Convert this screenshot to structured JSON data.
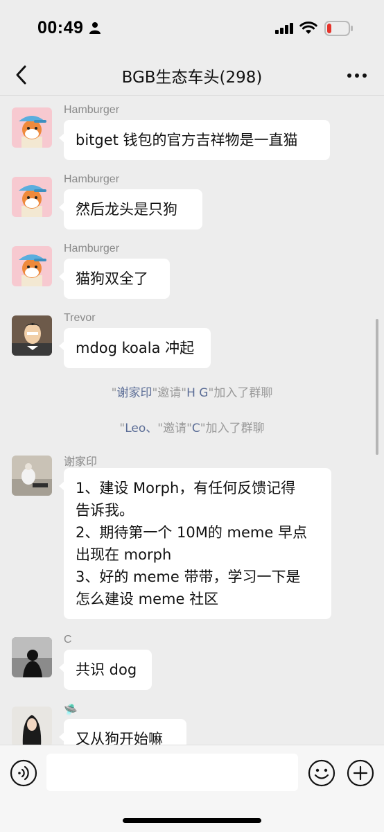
{
  "status_bar": {
    "time": "00:49",
    "battery_color": "#e5332a"
  },
  "header": {
    "title": "BGB生态车头(298)",
    "back_icon": "chevron-left-icon",
    "more_icon": "more-dots-icon"
  },
  "messages": [
    {
      "sender": "Hamburger",
      "text": "bitget 钱包的官方吉祥物是一直猫"
    },
    {
      "sender": "Hamburger",
      "text": "然后龙头是只狗"
    },
    {
      "sender": "Hamburger",
      "text": "猫狗双全了"
    },
    {
      "sender": "Trevor",
      "text": "mdog koala 冲起"
    },
    {
      "sender": "谢家印",
      "lines": [
        "1、建设 Morph，有任何反馈记得",
        "告诉我。",
        "2、期待第一个 10M的 meme 早点",
        "出现在 morph",
        "3、好的 meme 带带，学习一下是",
        "怎么建设 meme 社区"
      ]
    },
    {
      "sender": "C",
      "text": "共识 dog"
    },
    {
      "sender": "🛸",
      "text": "又从狗开始嘛"
    }
  ],
  "system_messages": [
    {
      "q1": "\"",
      "inviter": "谢家印",
      "q2": "\"邀请\"",
      "invitee": "H G",
      "q3": "\"加入了群聊"
    },
    {
      "q1": "\"",
      "inviter": "Leo、",
      "q2": "\"邀请\"",
      "invitee": "C",
      "q3": "\"加入了群聊"
    }
  ],
  "input_bar": {
    "placeholder": "",
    "voice_icon": "voice-icon",
    "emoji_icon": "emoji-icon",
    "plus_icon": "plus-icon"
  },
  "colors": {
    "background": "#ededed",
    "bubble": "#ffffff",
    "system_name": "#5b6d96"
  }
}
